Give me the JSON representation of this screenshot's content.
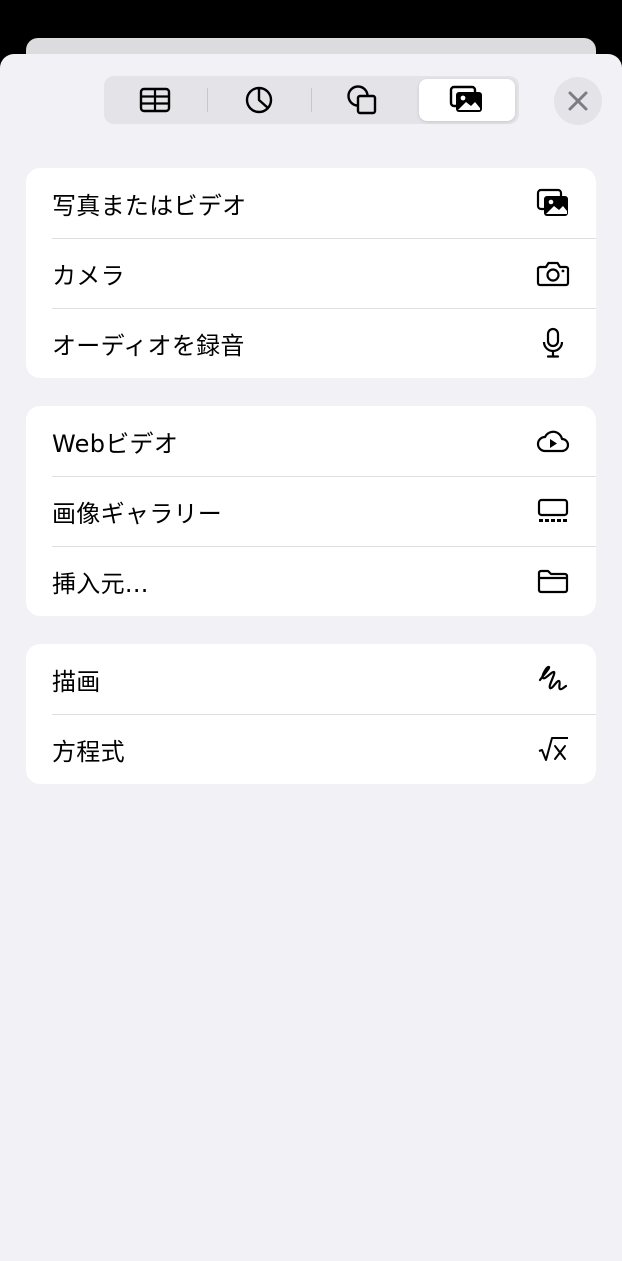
{
  "segments": [
    {
      "name": "table-icon",
      "selected": false
    },
    {
      "name": "chart-icon",
      "selected": false
    },
    {
      "name": "shape-icon",
      "selected": false
    },
    {
      "name": "media-icon",
      "selected": true
    }
  ],
  "close": {
    "icon": "close-icon"
  },
  "groups": [
    {
      "items": [
        {
          "label": "写真またはビデオ",
          "icon": "photo-stack-icon"
        },
        {
          "label": "カメラ",
          "icon": "camera-icon"
        },
        {
          "label": "オーディオを録音",
          "icon": "microphone-icon"
        }
      ]
    },
    {
      "items": [
        {
          "label": "Webビデオ",
          "icon": "cloud-play-icon"
        },
        {
          "label": "画像ギャラリー",
          "icon": "gallery-icon"
        },
        {
          "label": "挿入元...",
          "icon": "folder-icon"
        }
      ]
    },
    {
      "items": [
        {
          "label": "描画",
          "icon": "scribble-icon"
        },
        {
          "label": "方程式",
          "icon": "square-root-icon"
        }
      ]
    }
  ]
}
